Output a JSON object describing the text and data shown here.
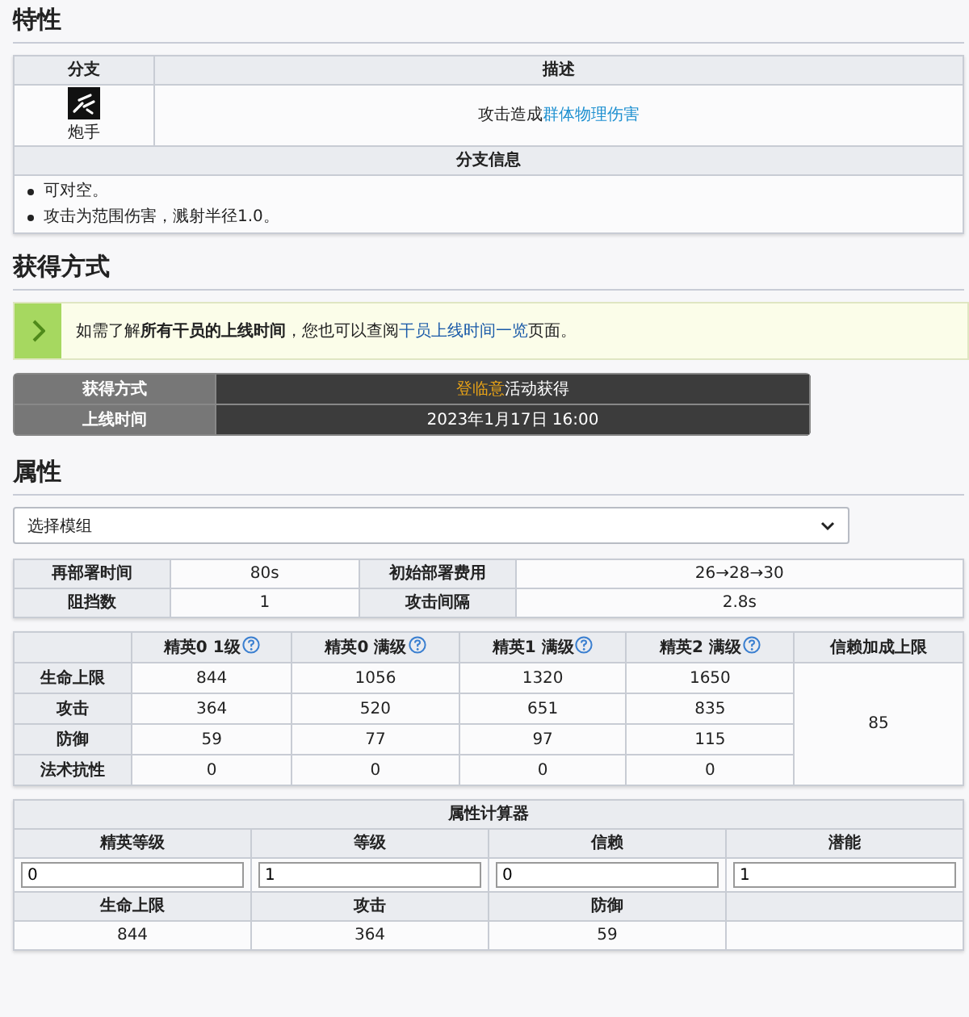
{
  "traits": {
    "heading": "特性",
    "columns": [
      "分支",
      "描述"
    ],
    "branch": {
      "name": "炮手"
    },
    "description": {
      "before": "攻击造成",
      "link": "群体物理伤害"
    },
    "info_heading": "分支信息",
    "info": [
      "可对空。",
      "攻击为范围伤害，溅射半径1.0。"
    ]
  },
  "acquisition": {
    "heading": "获得方式",
    "notice": {
      "text": "如需了解**所有干员的上线时间**，您也可以查阅",
      "link": "干员上线时间一览",
      "after": "页面。"
    },
    "rows": [
      {
        "label": "获得方式",
        "link": "登临意",
        "value": "活动获得"
      },
      {
        "label": "上线时间",
        "value": "2023年1月17日 16:00"
      }
    ]
  },
  "attributes": {
    "heading": "属性",
    "module_select": {
      "value": "选择模组"
    },
    "basic": [
      {
        "label": "再部署时间",
        "value": "80s"
      },
      {
        "label": "初始部署费用",
        "value": "26→28→30"
      },
      {
        "label": "阻挡数",
        "value": "1"
      },
      {
        "label": "攻击间隔",
        "value": "2.8s"
      }
    ],
    "stats": {
      "columns": [
        {
          "label": "精英0 1级",
          "help": true
        },
        {
          "label": "精英0 满级",
          "help": true
        },
        {
          "label": "精英1 满级",
          "help": true
        },
        {
          "label": "精英2 满级",
          "help": true
        }
      ],
      "trust_column": "信赖加成上限",
      "rows": [
        {
          "label": "生命上限",
          "values": [
            "844",
            "1056",
            "1320",
            "1650"
          ]
        },
        {
          "label": "攻击",
          "values": [
            "364",
            "520",
            "651",
            "835"
          ]
        },
        {
          "label": "防御",
          "values": [
            "59",
            "77",
            "97",
            "115"
          ]
        },
        {
          "label": "法术抗性",
          "values": [
            "0",
            "0",
            "0",
            "0"
          ]
        }
      ],
      "trust_value": "85"
    },
    "calculator": {
      "title": "属性计算器",
      "inputs": [
        {
          "label": "精英等级",
          "value": "0"
        },
        {
          "label": "等级",
          "value": "1"
        },
        {
          "label": "信赖",
          "value": "0"
        },
        {
          "label": "潜能",
          "value": "1"
        }
      ],
      "results": [
        {
          "label": "生命上限",
          "value": "844"
        },
        {
          "label": "攻击",
          "value": "364"
        },
        {
          "label": "防御",
          "value": "59"
        }
      ]
    }
  }
}
